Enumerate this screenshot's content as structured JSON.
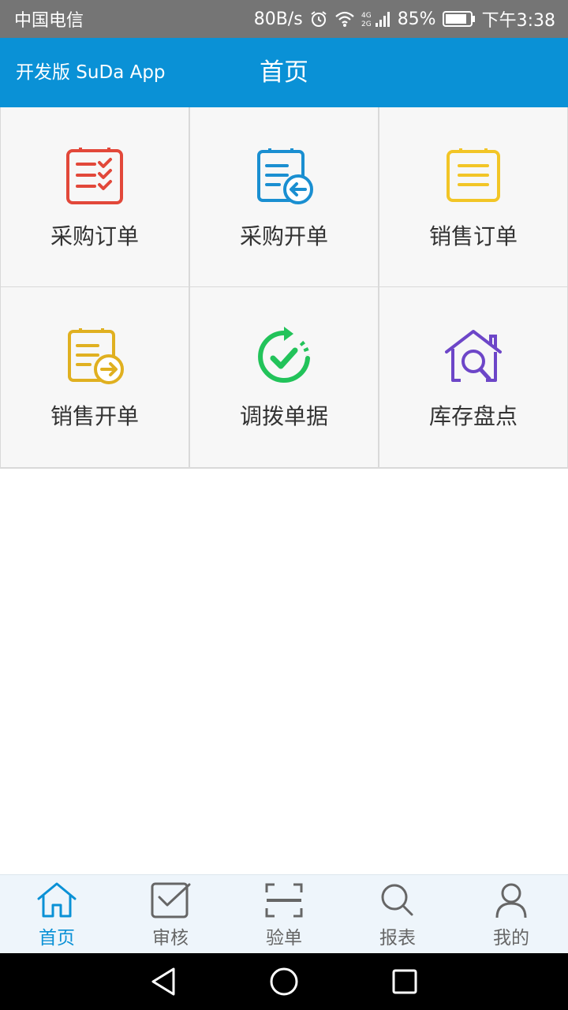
{
  "status_bar": {
    "carrier": "中国电信",
    "speed": "80B/s",
    "network": "4G",
    "battery": "85%",
    "time": "下午3:38"
  },
  "header": {
    "app_name": "开发版 SuDa App",
    "title": "首页",
    "color": "#0a91d6"
  },
  "grid": {
    "items": [
      {
        "label": "采购订单",
        "icon": "checklist-icon",
        "color": "#e2483a"
      },
      {
        "label": "采购开单",
        "icon": "document-arrow-in-icon",
        "color": "#1a8fd1"
      },
      {
        "label": "销售订单",
        "icon": "document-lines-icon",
        "color": "#f2c526"
      },
      {
        "label": "销售开单",
        "icon": "document-arrow-out-icon",
        "color": "#e0b020"
      },
      {
        "label": "调拨单据",
        "icon": "refresh-check-icon",
        "color": "#22c35a"
      },
      {
        "label": "库存盘点",
        "icon": "house-search-icon",
        "color": "#6d46c8"
      }
    ]
  },
  "tabbar": {
    "items": [
      {
        "label": "首页",
        "icon": "home-icon",
        "active": true
      },
      {
        "label": "审核",
        "icon": "checkbox-icon",
        "active": false
      },
      {
        "label": "验单",
        "icon": "scan-icon",
        "active": false
      },
      {
        "label": "报表",
        "icon": "search-icon",
        "active": false
      },
      {
        "label": "我的",
        "icon": "user-icon",
        "active": false
      }
    ],
    "active_color": "#0a91d6",
    "inactive_color": "#666666"
  },
  "nav": {
    "back": "back-icon",
    "home": "home-circle-icon",
    "recents": "recents-icon"
  }
}
